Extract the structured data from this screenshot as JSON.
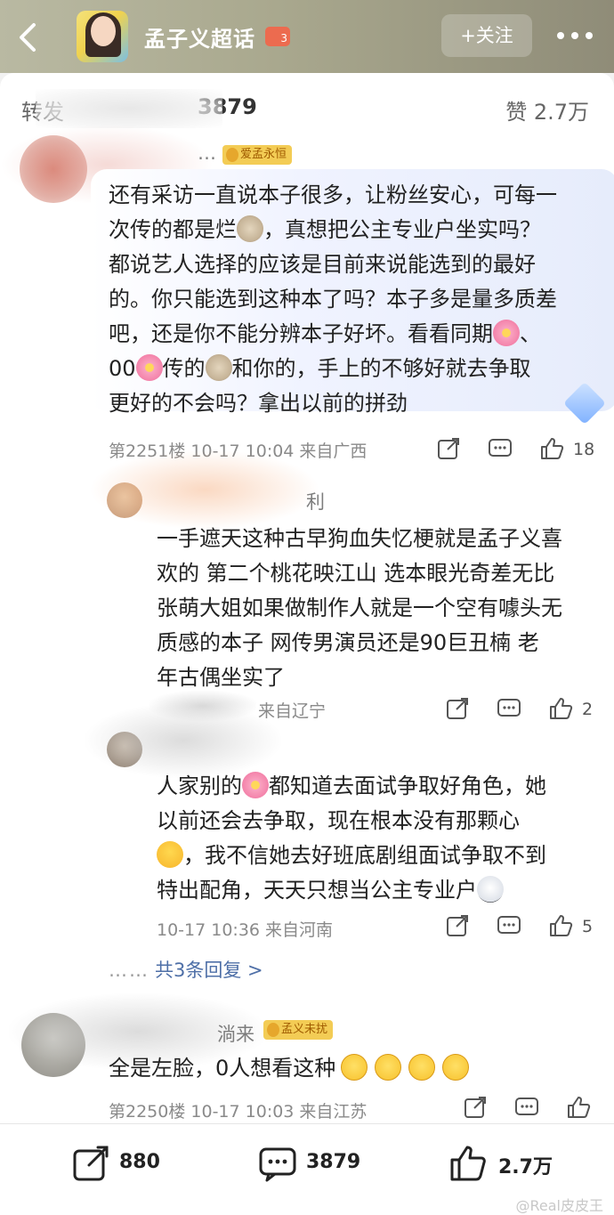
{
  "header": {
    "back_icon": "chevron-left-icon",
    "topic_title": "孟子义超话",
    "topic_badge": "3",
    "follow_label": "+关注",
    "more_icon": "more-dots-icon"
  },
  "stats": {
    "repost": "转发",
    "comments": "3879",
    "likes": "赞 2.7万"
  },
  "comments": [
    {
      "name_tail": "…",
      "badge": "爱孟永恒",
      "lines": [
        "还有采访一直说本子很多，让粉丝安心，可每一",
        "次传的都是烂",
        "，真想把公主专业户坐实吗？",
        "都说艺人选择的应该是目前来说能选到的最好",
        "的。你只能选到这种本了吗？本子多是量多质差",
        "吧，还是你不能分辨本子好坏。看看同期",
        "、",
        "00",
        "传的",
        "和你的，手上的不够好就去争取",
        "更好的不会吗？拿出以前的拼劲"
      ],
      "meta": "第2251楼 10-17 10:04 来自广西",
      "likes": "18"
    },
    {
      "name_tail": "利",
      "lines": [
        "一手遮天这种古早狗血失忆梗就是孟子义喜",
        "欢的 第二个桃花映江山 选本眼光奇差无比",
        "张萌大姐如果做制作人就是一个空有噱头无",
        "质感的本子 网传男演员还是90巨丑楠 老",
        "年古偶坐实了"
      ],
      "meta": "来自辽宁",
      "likes": "2"
    },
    {
      "lines": [
        "人家别的",
        "都知道去面试争取好角色，她",
        "以前还会去争取，现在根本没有那颗心",
        "，我不信她去好班底剧组面试争取不到",
        "特出配角，天天只想当公主专业户"
      ],
      "meta": "10-17 10:36 来自河南",
      "likes": "5"
    },
    {
      "more_replies_dots": "……",
      "more_replies_label": "共3条回复 >"
    },
    {
      "name_tail": "淌来",
      "badge": "孟义未扰",
      "lines": [
        "全是左脸，0人想看这种"
      ],
      "meta": "第2250楼 10-17 10:03 来自江苏"
    }
  ],
  "toolbar": {
    "repost_count": "880",
    "comment_count": "3879",
    "like_count": "2.7万",
    "watermark": "@Real皮皮王"
  },
  "colors": {
    "header_bg": "#a9a88e",
    "badge_gold": "#f3cc55",
    "link_blue": "#4e6fa7"
  }
}
